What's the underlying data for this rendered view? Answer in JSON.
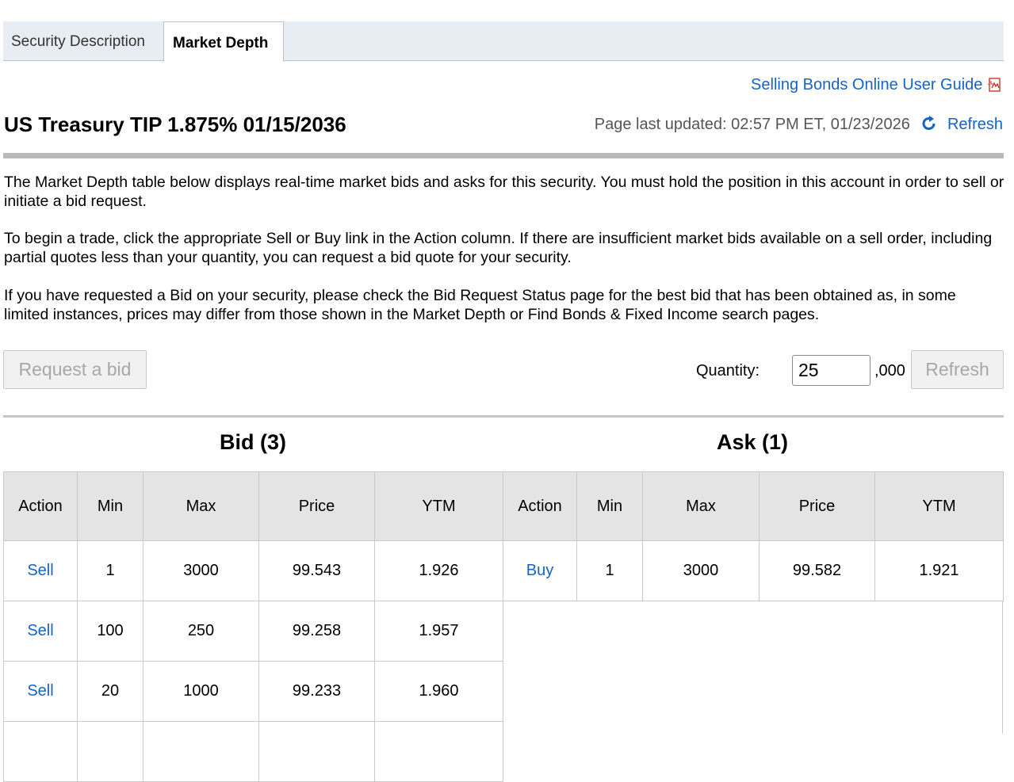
{
  "tabs": [
    "Security Description",
    "Market Depth"
  ],
  "user_guide_link": "Selling Bonds Online User Guide",
  "security_title": "US Treasury TIP 1.875% 01/15/2036",
  "last_updated": "Page last updated: 02:57 PM ET, 01/23/2026",
  "refresh_link": "Refresh",
  "paragraphs": [
    "The Market Depth table below displays real-time market bids and asks for this security. You must hold the position in this account in order to sell or initiate a bid request.",
    "To begin a trade, click the appropriate Sell or Buy link in the Action column. If there are insufficient market bids available on a sell order, including partial quotes less than your quantity, you can request a bid quote for your security.",
    "If you have requested a Bid on your security, please check the Bid Request Status page for the best bid that has been obtained as, in some limited instances, prices may differ from those shown in the Market Depth or Find Bonds & Fixed Income search pages."
  ],
  "request_bid_button": "Request a bid",
  "quantity": {
    "label": "Quantity:",
    "value": "25",
    "suffix": ",000",
    "refresh_button": "Refresh"
  },
  "bid": {
    "title": "Bid (3)",
    "columns": [
      "Action",
      "Min",
      "Max",
      "Price",
      "YTM"
    ],
    "rows": [
      {
        "action": "Sell",
        "min": "1",
        "max": "3000",
        "price": "99.543",
        "ytm": "1.926"
      },
      {
        "action": "Sell",
        "min": "100",
        "max": "250",
        "price": "99.258",
        "ytm": "1.957"
      },
      {
        "action": "Sell",
        "min": "20",
        "max": "1000",
        "price": "99.233",
        "ytm": "1.960"
      }
    ]
  },
  "ask": {
    "title": "Ask (1)",
    "columns": [
      "Action",
      "Min",
      "Max",
      "Price",
      "YTM"
    ],
    "rows": [
      {
        "action": "Buy",
        "min": "1",
        "max": "3000",
        "price": "99.582",
        "ytm": "1.921"
      }
    ]
  },
  "colors": {
    "link": "#1464c8",
    "tabbar": "#e8edf3",
    "header_bg": "#e4e4e4",
    "rule": "#b9b9b9"
  },
  "icons": [
    "pdf-icon",
    "refresh-icon"
  ]
}
